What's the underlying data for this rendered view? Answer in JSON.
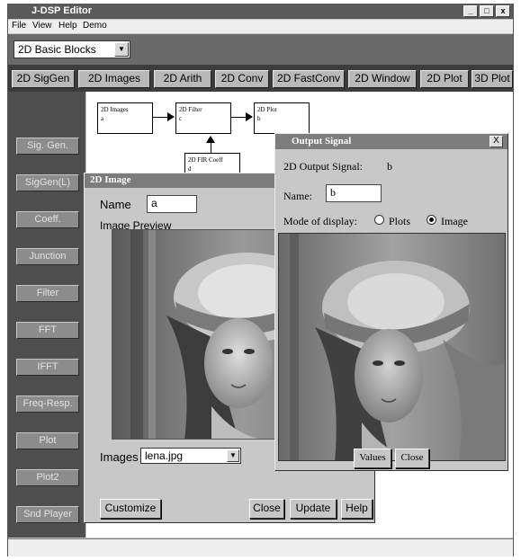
{
  "window": {
    "title": "J-DSP Editor",
    "controls": {
      "minimize": "_",
      "maximize": "□",
      "close": "x"
    }
  },
  "menu": [
    "File",
    "View",
    "Help",
    "Demo"
  ],
  "block_category": {
    "selected": "2D Basic Blocks"
  },
  "tabs": [
    "2D SigGen",
    "2D Images",
    "2D Arith",
    "2D Conv",
    "2D FastConv",
    "2D Window",
    "2D Plot",
    "3D Plot"
  ],
  "palette": [
    "Sig. Gen.",
    "SigGen(L)",
    "Coeff.",
    "Junction",
    "Filter",
    "FFT",
    "IFFT",
    "Freq-Resp.",
    "Plot",
    "Plot2",
    "Snd Player"
  ],
  "blocks": [
    {
      "title": "2D Images",
      "name": "a"
    },
    {
      "title": "2D Filter",
      "name": "c"
    },
    {
      "title": "2D Plot",
      "name": "b"
    },
    {
      "title": "2D FIR Coeff",
      "name": "d"
    }
  ],
  "image_dialog": {
    "title": "2D Image",
    "name_label": "Name",
    "name_value": "a",
    "preview_label": "Image Preview",
    "images_label": "Images",
    "images_selected": "lena.jpg",
    "buttons": {
      "customize": "Customize",
      "close": "Close",
      "update": "Update",
      "help": "Help"
    }
  },
  "output_dialog": {
    "title": "Output Signal",
    "close_glyph": "X",
    "signal_label": "2D Output Signal:",
    "signal_value": "b",
    "name_label": "Name:",
    "name_value": "b",
    "mode_label": "Mode of display:",
    "mode_options": [
      "Plots",
      "Image"
    ],
    "mode_selected": "Image",
    "buttons": {
      "values": "Values",
      "close": "Close"
    }
  }
}
